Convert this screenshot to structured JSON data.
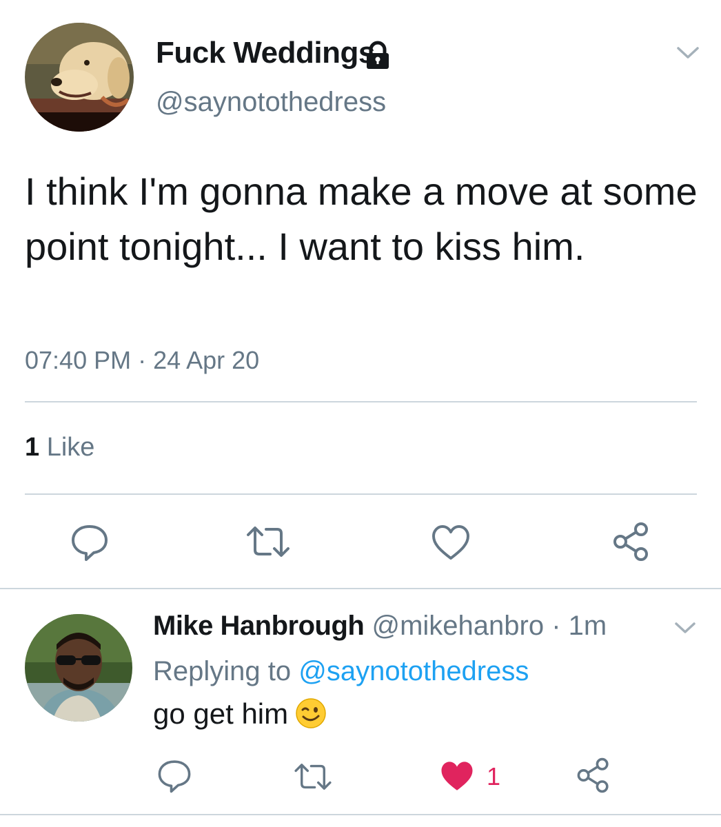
{
  "tweet": {
    "author": {
      "display_name": "Fuck Weddings",
      "handle": "@saynotothedress",
      "avatar_icon": "dog-avatar",
      "protected_icon": "lock-icon"
    },
    "text": "I think I'm gonna make a move at some point tonight... I want to kiss him.",
    "timestamp": "07:40 PM · 24 Apr 20",
    "likes": {
      "count": "1",
      "label": "Like"
    },
    "actions": [
      "reply-icon",
      "retweet-icon",
      "like-icon",
      "share-icon"
    ]
  },
  "reply": {
    "author": {
      "display_name": "Mike Hanbrough",
      "handle": "@mikehanbro",
      "time": "· 1m",
      "avatar_icon": "man-avatar"
    },
    "replying_to_prefix": "Replying to",
    "replying_to_handle": "@saynotothedress",
    "text": "go get him",
    "emoji": "wink-emoji",
    "like_count": "1",
    "actions": [
      "reply-icon",
      "retweet-icon",
      "like-icon-filled",
      "share-icon"
    ]
  },
  "colors": {
    "text": "#14171a",
    "secondary": "#657786",
    "link": "#1da1f2",
    "like": "#e0245e",
    "divider": "#ccd6dd"
  }
}
